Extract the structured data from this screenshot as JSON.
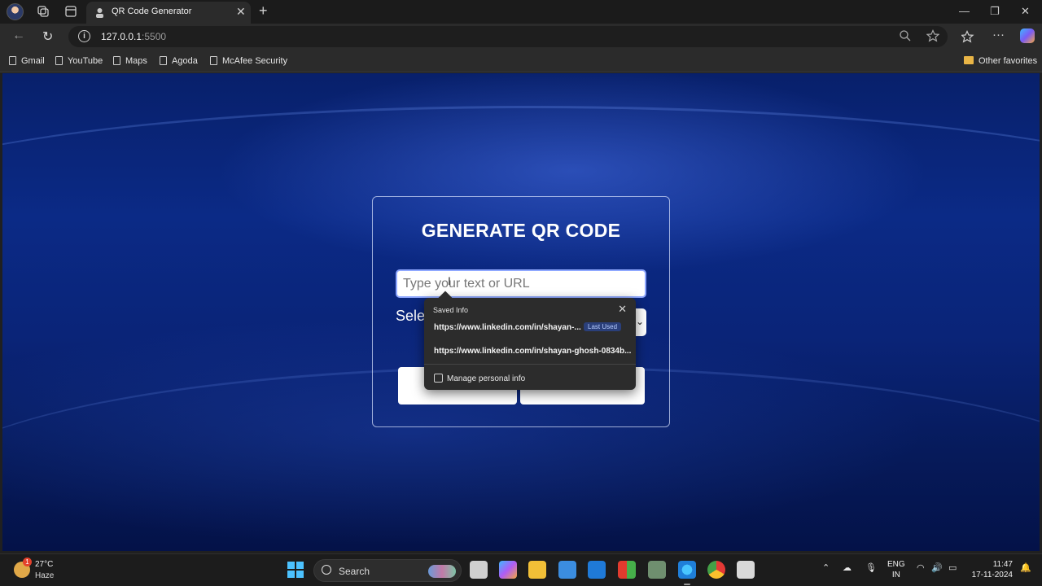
{
  "browser": {
    "tab_title": "QR Code Generator",
    "url_host": "127.0.0.1",
    "url_port": ":5500",
    "bookmarks": [
      "Gmail",
      "YouTube",
      "Maps",
      "Agoda",
      "McAfee Security"
    ],
    "other_favorites": "Other favorites"
  },
  "page": {
    "heading": "GENERATE QR CODE",
    "input_placeholder": "Type your text or URL",
    "select_label": "Sele"
  },
  "autofill": {
    "title": "Saved Info",
    "items": [
      {
        "text": "https://www.linkedin.com/in/shayan-...",
        "badge": "Last Used"
      },
      {
        "text": "https://www.linkedin.com/in/shayan-ghosh-0834b..."
      }
    ],
    "manage": "Manage personal info"
  },
  "taskbar": {
    "weather_temp": "27°C",
    "weather_desc": "Haze",
    "weather_badge": "1",
    "search": "Search",
    "lang_1": "ENG",
    "lang_2": "IN",
    "time": "11:47",
    "date": "17-11-2024"
  }
}
